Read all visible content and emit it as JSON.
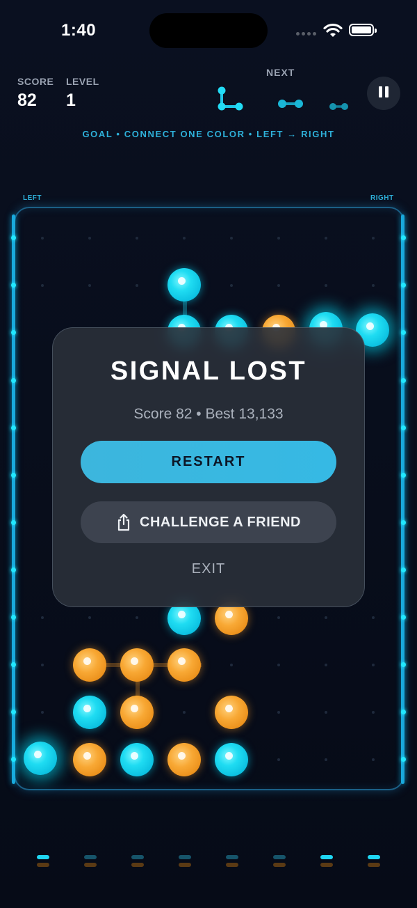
{
  "status_bar": {
    "time": "1:40"
  },
  "hud": {
    "score_label": "SCORE",
    "score_value": "82",
    "level_label": "LEVEL",
    "level_value": "1",
    "next_label": "NEXT",
    "goal_text": "GOAL  •  CONNECT ONE COLOR  •  LEFT → RIGHT"
  },
  "board": {
    "left_label": "LEFT",
    "right_label": "RIGHT",
    "colors": {
      "cyan": "#1fdcf2",
      "orange": "#f39c2a",
      "rail": "#19a9dc"
    }
  },
  "modal": {
    "title": "SIGNAL LOST",
    "stats": "Score  82  •  Best  13,133",
    "restart_label": "RESTART",
    "challenge_label": "CHALLENGE A FRIEND",
    "challenge_icon": "share-icon",
    "exit_label": "EXIT"
  },
  "icons": [
    "pause-icon",
    "wifi-icon",
    "battery-icon",
    "share-icon"
  ]
}
